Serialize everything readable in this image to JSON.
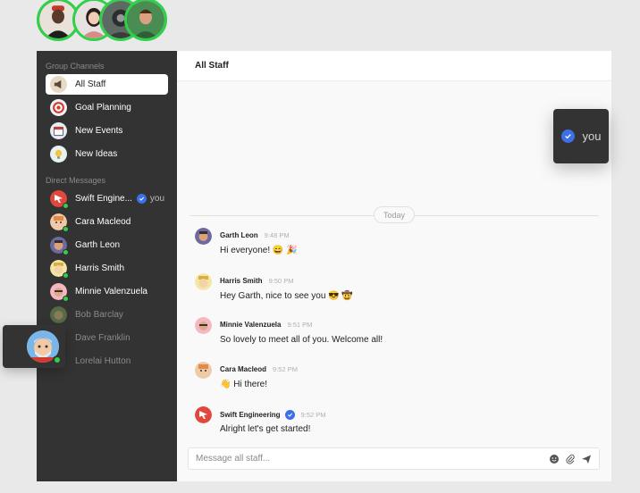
{
  "top_avatars": [
    "avatar-1",
    "avatar-2",
    "avatar-3",
    "avatar-4"
  ],
  "sidebar": {
    "group_heading": "Group Channels",
    "channels": [
      {
        "label": "All Staff",
        "icon": "megaphone-icon",
        "active": true
      },
      {
        "label": "Goal Planning",
        "icon": "target-icon",
        "active": false
      },
      {
        "label": "New Events",
        "icon": "calendar-icon",
        "active": false
      },
      {
        "label": "New Ideas",
        "icon": "lightbulb-icon",
        "active": false
      }
    ],
    "dm_heading": "Direct Messages",
    "direct_messages": [
      {
        "label": "Swift Engine...",
        "you": "you",
        "online": true
      },
      {
        "label": "Cara Macleod",
        "online": true
      },
      {
        "label": "Garth Leon",
        "online": true
      },
      {
        "label": "Harris Smith",
        "online": true
      },
      {
        "label": "Minnie Valenzuela",
        "online": true
      },
      {
        "label": "Bob Barclay",
        "online": false
      },
      {
        "label": "Dave Franklin",
        "online": false
      },
      {
        "label": "Lorelai Hutton",
        "online": false
      }
    ]
  },
  "main": {
    "header_title": "All Staff",
    "day_separator": "Today",
    "messages": [
      {
        "name": "Garth Leon",
        "time": "9:48 PM",
        "text": "Hi everyone! 😄 🎉"
      },
      {
        "name": "Harris Smith",
        "time": "9:50 PM",
        "text": "Hey Garth, nice to see you 😎 🤠"
      },
      {
        "name": "Minnie Valenzuela",
        "time": "9:51 PM",
        "text": "So lovely to meet all of you. Welcome all!"
      },
      {
        "name": "Cara Macleod",
        "time": "9:52 PM",
        "text": "👋  Hi there!"
      },
      {
        "name": "Swift Engineering",
        "time": "9:52 PM",
        "text": "Alright let's get started!",
        "verified": true
      }
    ],
    "composer": {
      "placeholder": "Message all staff..."
    }
  },
  "you_card": {
    "label": "you"
  },
  "colors": {
    "sidebar_bg": "#333333",
    "online": "#2fd04a",
    "verified": "#3d6fe6",
    "brand_red": "#e0483e"
  }
}
